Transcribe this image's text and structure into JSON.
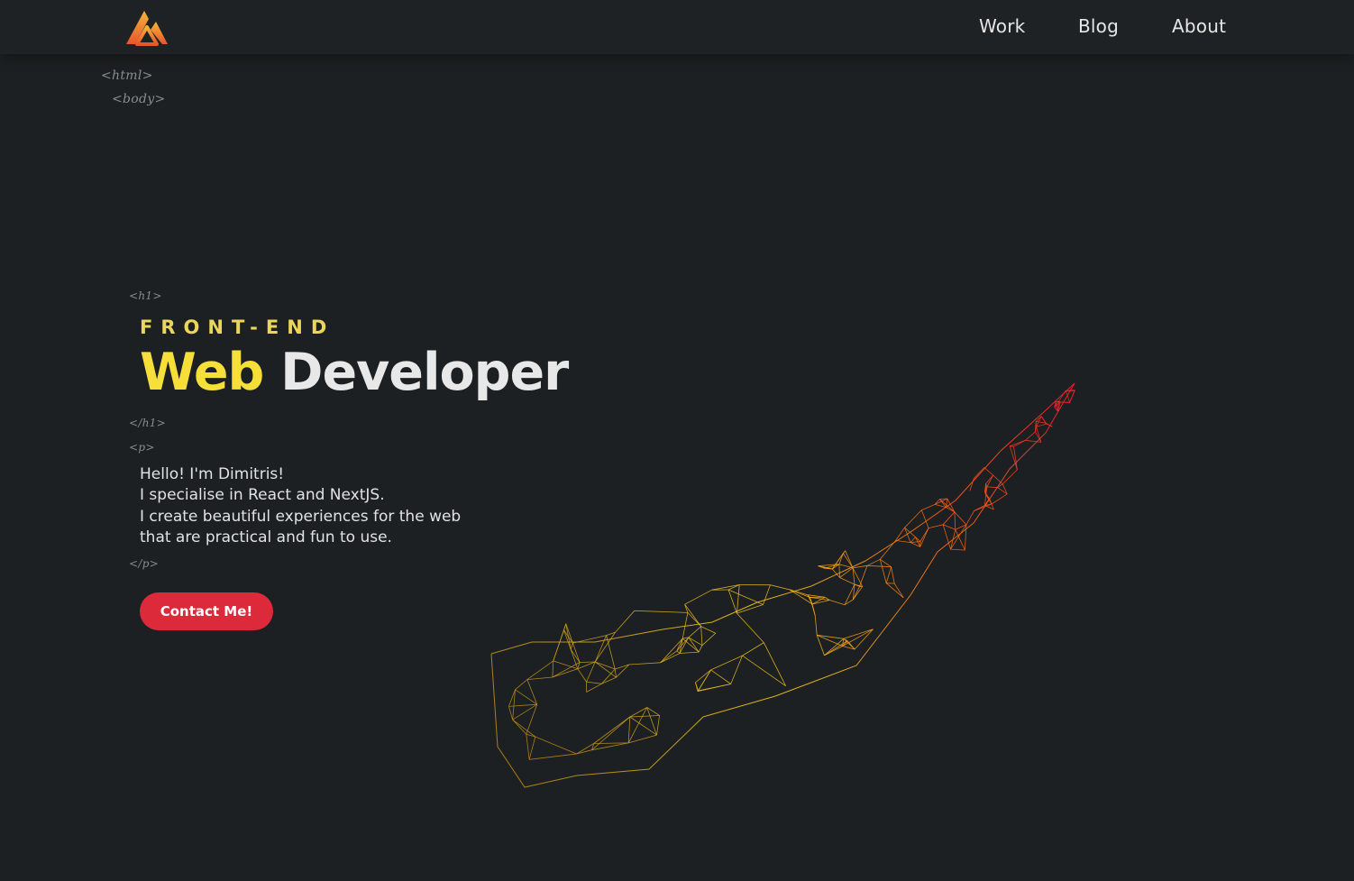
{
  "nav": {
    "links": [
      {
        "label": "Work"
      },
      {
        "label": "Blog"
      },
      {
        "label": "About"
      }
    ]
  },
  "code_tags": {
    "html_open": "<html>",
    "body_open": "<body>",
    "h1_open": "<h1>",
    "h1_close": "</h1>",
    "p_open": "<p>",
    "p_close": "</p>"
  },
  "hero": {
    "subtitle": "FRONT-END",
    "title_accent": "Web",
    "title_rest": "Developer",
    "intro_lines": [
      "Hello! I'm Dimitris!",
      "I specialise in React and NextJS.",
      "I create beautiful experiences for the web",
      "that are practical and fun to use."
    ],
    "cta_label": "Contact Me!"
  },
  "colors": {
    "background": "#1d2022",
    "accent_yellow": "#f7df3a",
    "accent_red": "#dc2a3a",
    "mesh_start": "#b8861c",
    "mesh_mid": "#f2c71a",
    "mesh_end": "#ff1a2e"
  }
}
